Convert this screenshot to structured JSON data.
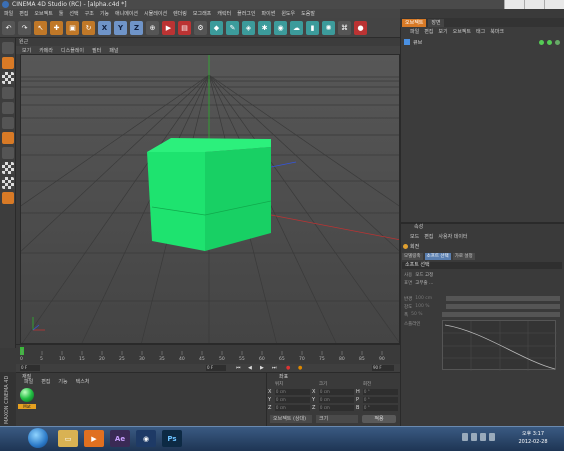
{
  "window": {
    "title": "CINEMA 4D Studio (RC) - [alpha.c4d *]"
  },
  "menubar": [
    "파일",
    "편집",
    "오브젝트",
    "툴",
    "선택",
    "구조",
    "기능",
    "애니메이션",
    "시뮬레이션",
    "렌더링",
    "모그래프",
    "캐릭터",
    "플러그인",
    "파이썬",
    "윈도우",
    "도움말"
  ],
  "toolbar": {
    "axis_labels": [
      "X",
      "Y",
      "Z"
    ]
  },
  "viewport": {
    "name": "원근",
    "menu": [
      "보기",
      "카메라",
      "디스플레이",
      "필터",
      "패널"
    ]
  },
  "timeline": {
    "frame_field": "0 F",
    "ticks": [
      "0",
      "5",
      "10",
      "15",
      "20",
      "25",
      "30",
      "35",
      "40",
      "45",
      "50",
      "55",
      "60",
      "65",
      "70",
      "75",
      "80",
      "85",
      "90"
    ],
    "start_field": "0 F",
    "end_field": "90 F"
  },
  "material_manager": {
    "title": "재질",
    "menu": [
      "파일",
      "편집",
      "기능",
      "텍스처"
    ],
    "material_name": "Mat",
    "maxon_label": "MAXON CINEMA 4D"
  },
  "coordinates": {
    "title": "좌표",
    "headers": [
      "위치",
      "크기",
      "회전"
    ],
    "rows": [
      {
        "axis": "X",
        "pos": "0 cm",
        "size": "0 cm",
        "rot_axis": "H",
        "rot": "0 °"
      },
      {
        "axis": "Y",
        "pos": "0 cm",
        "size": "0 cm",
        "rot_axis": "P",
        "rot": "0 °"
      },
      {
        "axis": "Z",
        "pos": "0 cm",
        "size": "0 cm",
        "rot_axis": "B",
        "rot": "0 °"
      }
    ],
    "dropdown1": "오브젝트 (상대)",
    "dropdown2": "크기",
    "apply_label": "적용"
  },
  "object_manager": {
    "tabs": [
      "오브젝트",
      "장면"
    ],
    "menu": [
      "파일",
      "편집",
      "보기",
      "오브젝트",
      "태그",
      "북마크"
    ],
    "object_name": "큐브"
  },
  "attribute_manager": {
    "title": "속성",
    "menu": [
      "모드",
      "편집",
      "사용자 데이터"
    ],
    "mode_label": "회전",
    "tabs": [
      "모델링축",
      "소프트 선택",
      "가로 설정"
    ],
    "section": "소프트 선택",
    "rows": [
      {
        "label": "사용",
        "value": "모드 고정"
      },
      {
        "label": "표면",
        "value": "고무줄 ..."
      },
      {
        "label": "반경",
        "value": "100 cm"
      },
      {
        "label": "강도",
        "value": "100 %"
      },
      {
        "label": "폭",
        "value": "50 %"
      },
      {
        "label": "스플라인",
        "value": ""
      }
    ]
  },
  "taskbar": {
    "apps": [
      "Ae",
      "Ps"
    ],
    "time": "오후 3:17",
    "date": "2012-02-28"
  },
  "colors": {
    "cube": "#1ee36f",
    "accent": "#d87a26"
  }
}
